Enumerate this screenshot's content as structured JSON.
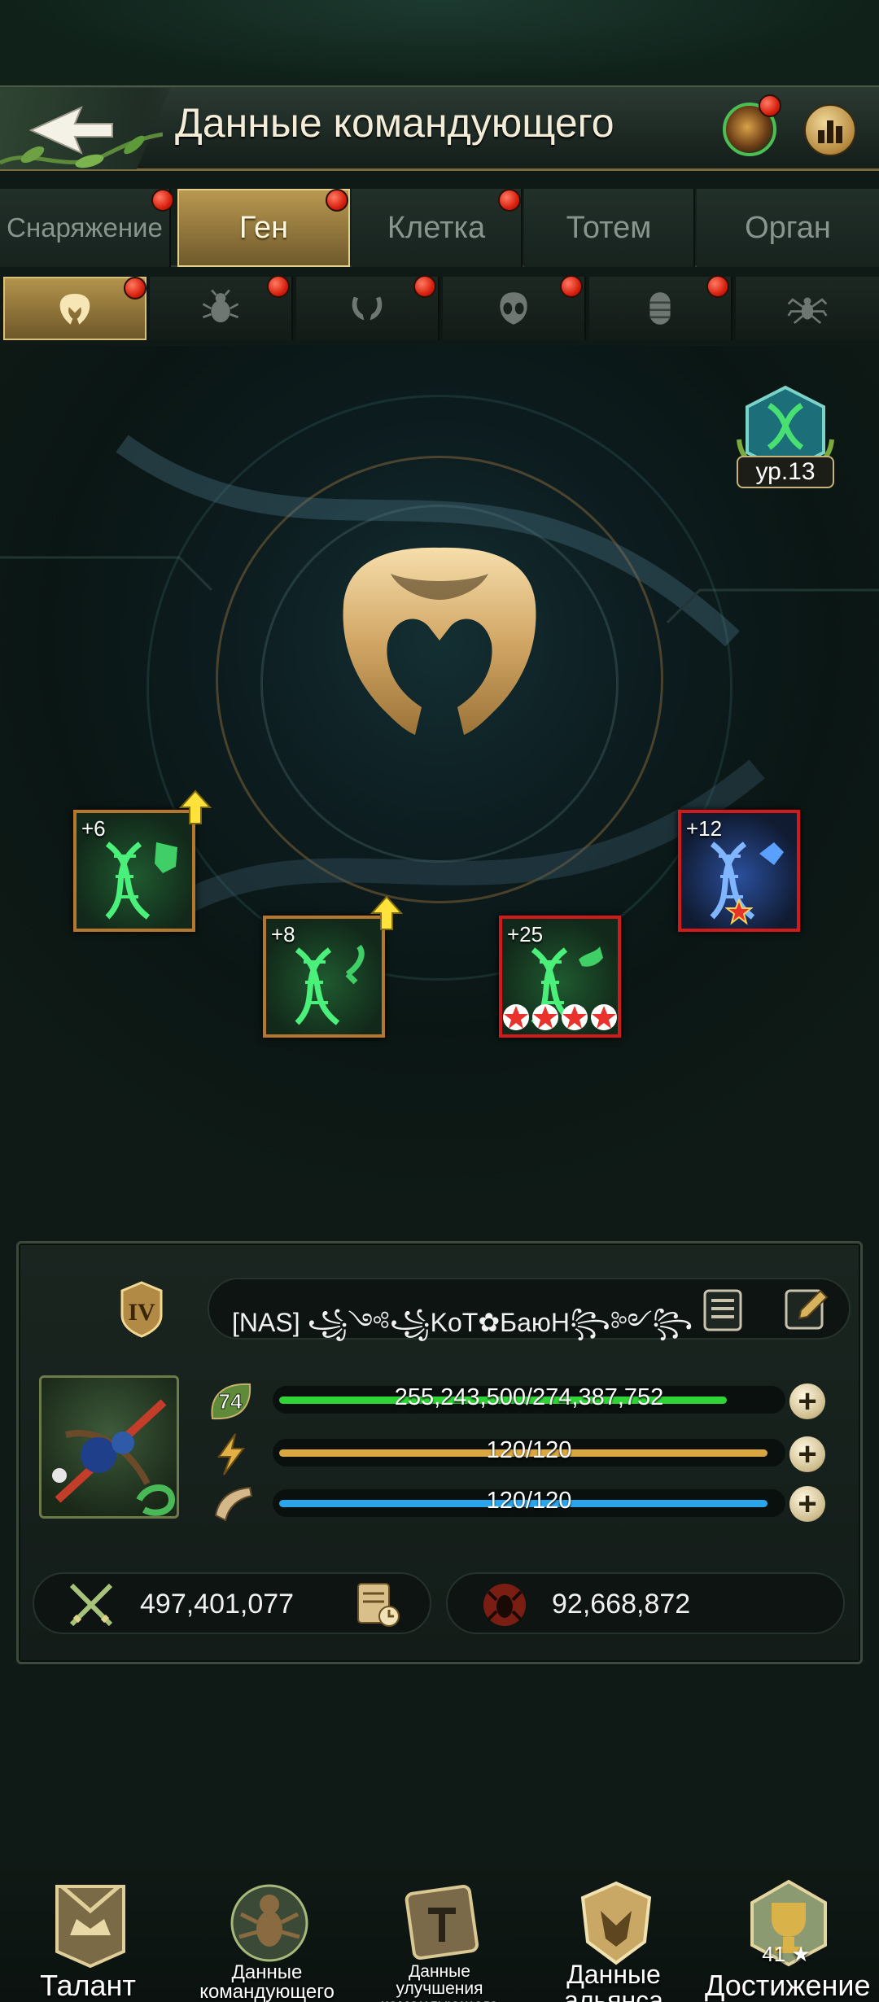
{
  "header": {
    "title": "Данные командующего"
  },
  "tabs": [
    {
      "label": "Снаряжение",
      "active": false,
      "badge": true
    },
    {
      "label": "Ген",
      "active": true,
      "badge": true
    },
    {
      "label": "Клетка",
      "active": false,
      "badge": true
    },
    {
      "label": "Тотем",
      "active": false,
      "badge": false
    },
    {
      "label": "Орган",
      "active": false,
      "badge": false
    }
  ],
  "subtabs": [
    {
      "icon": "ant-head-icon",
      "active": true
    },
    {
      "icon": "beetle-icon",
      "active": false
    },
    {
      "icon": "mandibles-icon",
      "active": false
    },
    {
      "icon": "skull-icon",
      "active": false
    },
    {
      "icon": "larva-icon",
      "active": false
    },
    {
      "icon": "spider-icon",
      "active": false
    }
  ],
  "gene": {
    "level_label": "ур.13",
    "cards": [
      {
        "level": "+6",
        "stars": 0,
        "upgrade": true,
        "rarity": "orange",
        "style": "green"
      },
      {
        "level": "+8",
        "stars": 0,
        "upgrade": true,
        "rarity": "orange",
        "style": "green"
      },
      {
        "level": "+25",
        "stars": 4,
        "upgrade": false,
        "rarity": "red",
        "style": "green"
      },
      {
        "level": "+12",
        "stars": 1,
        "upgrade": false,
        "rarity": "red",
        "style": "blue"
      }
    ]
  },
  "profile": {
    "rank": "IV",
    "name": "[NAS]  ꧁༺꧁KoT✿БаюН꧂༻꧂",
    "level": "74",
    "stats": {
      "exp": {
        "text": "255,243,500/274,387,752",
        "fill": 0.93,
        "color": "#2fd336"
      },
      "energy": {
        "text": "120/120",
        "fill": 1.0,
        "color": "#d9a640"
      },
      "horn": {
        "text": "120/120",
        "fill": 1.0,
        "color": "#2aa4ea"
      }
    },
    "power": "497,401,077",
    "kills": "92,668,872"
  },
  "nav": [
    {
      "label": "Талант"
    },
    {
      "label": "Данные командующего"
    },
    {
      "label": "Данные улучшения командующего"
    },
    {
      "label": "Данные альянса"
    },
    {
      "label": "Достижение",
      "count": "41 ★"
    }
  ]
}
